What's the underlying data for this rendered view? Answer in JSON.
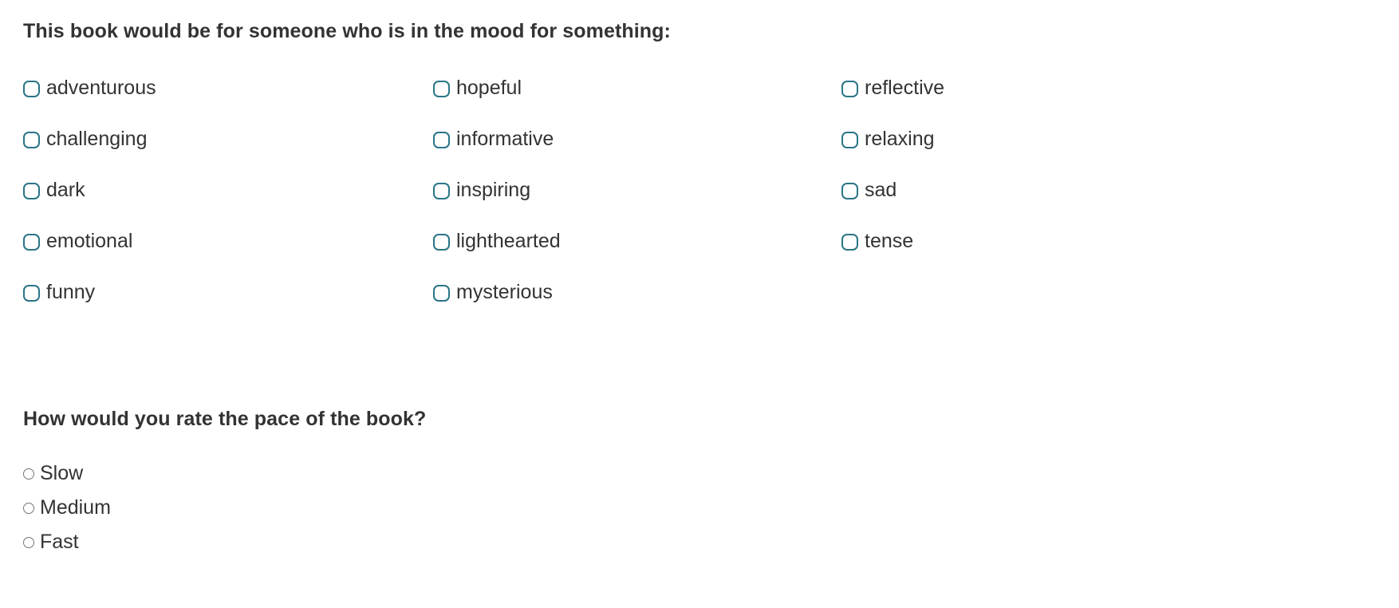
{
  "theme": {
    "checkbox_border_color": "#2a7587",
    "radio_border_color": "#767676",
    "text_color": "#333333",
    "background_color": "#ffffff"
  },
  "mood_question": {
    "heading": "This book would be for someone who is in the mood for something:",
    "columns": [
      {
        "options": [
          {
            "label": "adventurous",
            "checked": false
          },
          {
            "label": "challenging",
            "checked": false
          },
          {
            "label": "dark",
            "checked": false
          },
          {
            "label": "emotional",
            "checked": false
          },
          {
            "label": "funny",
            "checked": false
          }
        ]
      },
      {
        "options": [
          {
            "label": "hopeful",
            "checked": false
          },
          {
            "label": "informative",
            "checked": false
          },
          {
            "label": "inspiring",
            "checked": false
          },
          {
            "label": "lighthearted",
            "checked": false
          },
          {
            "label": "mysterious",
            "checked": false
          }
        ]
      },
      {
        "options": [
          {
            "label": "reflective",
            "checked": false
          },
          {
            "label": "relaxing",
            "checked": false
          },
          {
            "label": "sad",
            "checked": false
          },
          {
            "label": "tense",
            "checked": false
          }
        ]
      }
    ]
  },
  "pace_question": {
    "heading": "How would you rate the pace of the book?",
    "options": [
      {
        "label": "Slow",
        "selected": false
      },
      {
        "label": "Medium",
        "selected": false
      },
      {
        "label": "Fast",
        "selected": false
      }
    ]
  }
}
